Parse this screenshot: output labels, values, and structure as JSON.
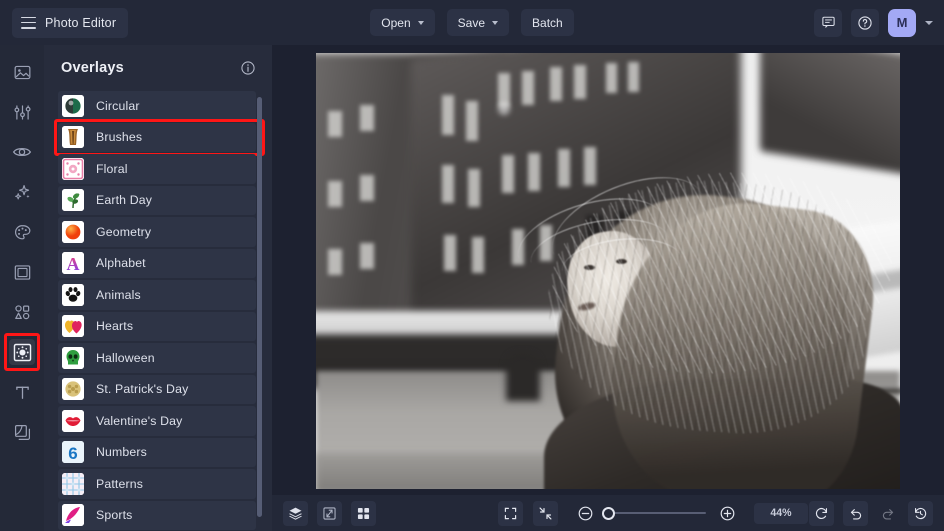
{
  "app": {
    "title": "Photo Editor"
  },
  "topbar": {
    "menu_icon": "hamburger-icon",
    "buttons": [
      {
        "label": "Open",
        "has_caret": true,
        "name": "open-button"
      },
      {
        "label": "Save",
        "has_caret": true,
        "name": "save-button"
      },
      {
        "label": "Batch",
        "has_caret": false,
        "name": "batch-button"
      }
    ],
    "feedback_icon": "chat-bubble-icon",
    "help_icon": "question-circle-icon",
    "avatar_initial": "M",
    "avatar_color": "#a3a9f5",
    "account_caret": "chevron-down-icon"
  },
  "rail": {
    "items": [
      {
        "name": "sidebar-item-image",
        "icon": "image-icon",
        "active": false
      },
      {
        "name": "sidebar-item-adjust",
        "icon": "sliders-icon",
        "active": false
      },
      {
        "name": "sidebar-item-retouch",
        "icon": "eye-icon",
        "active": false
      },
      {
        "name": "sidebar-item-effects",
        "icon": "sparkles-icon",
        "active": false
      },
      {
        "name": "sidebar-item-color",
        "icon": "palette-icon",
        "active": false
      },
      {
        "name": "sidebar-item-frames",
        "icon": "frame-icon",
        "active": false
      },
      {
        "name": "sidebar-item-shapes",
        "icon": "shapes-icon",
        "active": false
      },
      {
        "name": "sidebar-item-overlays",
        "icon": "overlays-icon",
        "active": true
      },
      {
        "name": "sidebar-item-text",
        "icon": "text-t-icon",
        "active": false
      },
      {
        "name": "sidebar-item-layers",
        "icon": "layers-copy-icon",
        "active": false
      }
    ],
    "highlight_index": 7,
    "highlight_color": "#ff1616"
  },
  "panel": {
    "title": "Overlays",
    "info_icon": "info-circle-icon",
    "highlight_index": 1,
    "highlight_color": "#ff1616",
    "items": [
      {
        "label": "Circular",
        "thumb": "circular-thumb"
      },
      {
        "label": "Brushes",
        "thumb": "brushes-thumb"
      },
      {
        "label": "Floral",
        "thumb": "floral-thumb"
      },
      {
        "label": "Earth Day",
        "thumb": "earth-day-thumb"
      },
      {
        "label": "Geometry",
        "thumb": "geometry-thumb"
      },
      {
        "label": "Alphabet",
        "thumb": "alphabet-thumb"
      },
      {
        "label": "Animals",
        "thumb": "animals-thumb"
      },
      {
        "label": "Hearts",
        "thumb": "hearts-thumb"
      },
      {
        "label": "Halloween",
        "thumb": "halloween-thumb"
      },
      {
        "label": "St. Patrick's Day",
        "thumb": "st-patricks-thumb"
      },
      {
        "label": "Valentine's Day",
        "thumb": "valentines-thumb"
      },
      {
        "label": "Numbers",
        "thumb": "numbers-thumb"
      },
      {
        "label": "Patterns",
        "thumb": "patterns-thumb"
      },
      {
        "label": "Sports",
        "thumb": "sports-thumb"
      }
    ]
  },
  "canvas": {
    "image_description": "Black and white photo of a woman with long windblown hair in a city square"
  },
  "bottombar": {
    "left_icons": [
      {
        "name": "layers-button",
        "icon": "layers-icon"
      },
      {
        "name": "transform-button",
        "icon": "resize-icon"
      },
      {
        "name": "grid-button",
        "icon": "grid-icon"
      }
    ],
    "center_icons": [
      {
        "name": "fullscreen-button",
        "icon": "expand-corners-icon"
      },
      {
        "name": "fit-screen-button",
        "icon": "collapse-corners-icon"
      }
    ],
    "zoom_out_icon": "minus-circle-icon",
    "zoom_in_icon": "plus-circle-icon",
    "zoom_value": "44%",
    "right_icons": [
      {
        "name": "reset-button",
        "icon": "refresh-icon",
        "disabled": false
      },
      {
        "name": "undo-button",
        "icon": "undo-arrow-icon",
        "disabled": false
      },
      {
        "name": "redo-button",
        "icon": "redo-arrow-icon",
        "disabled": true
      },
      {
        "name": "history-button",
        "icon": "clock-history-icon",
        "disabled": false
      }
    ]
  }
}
